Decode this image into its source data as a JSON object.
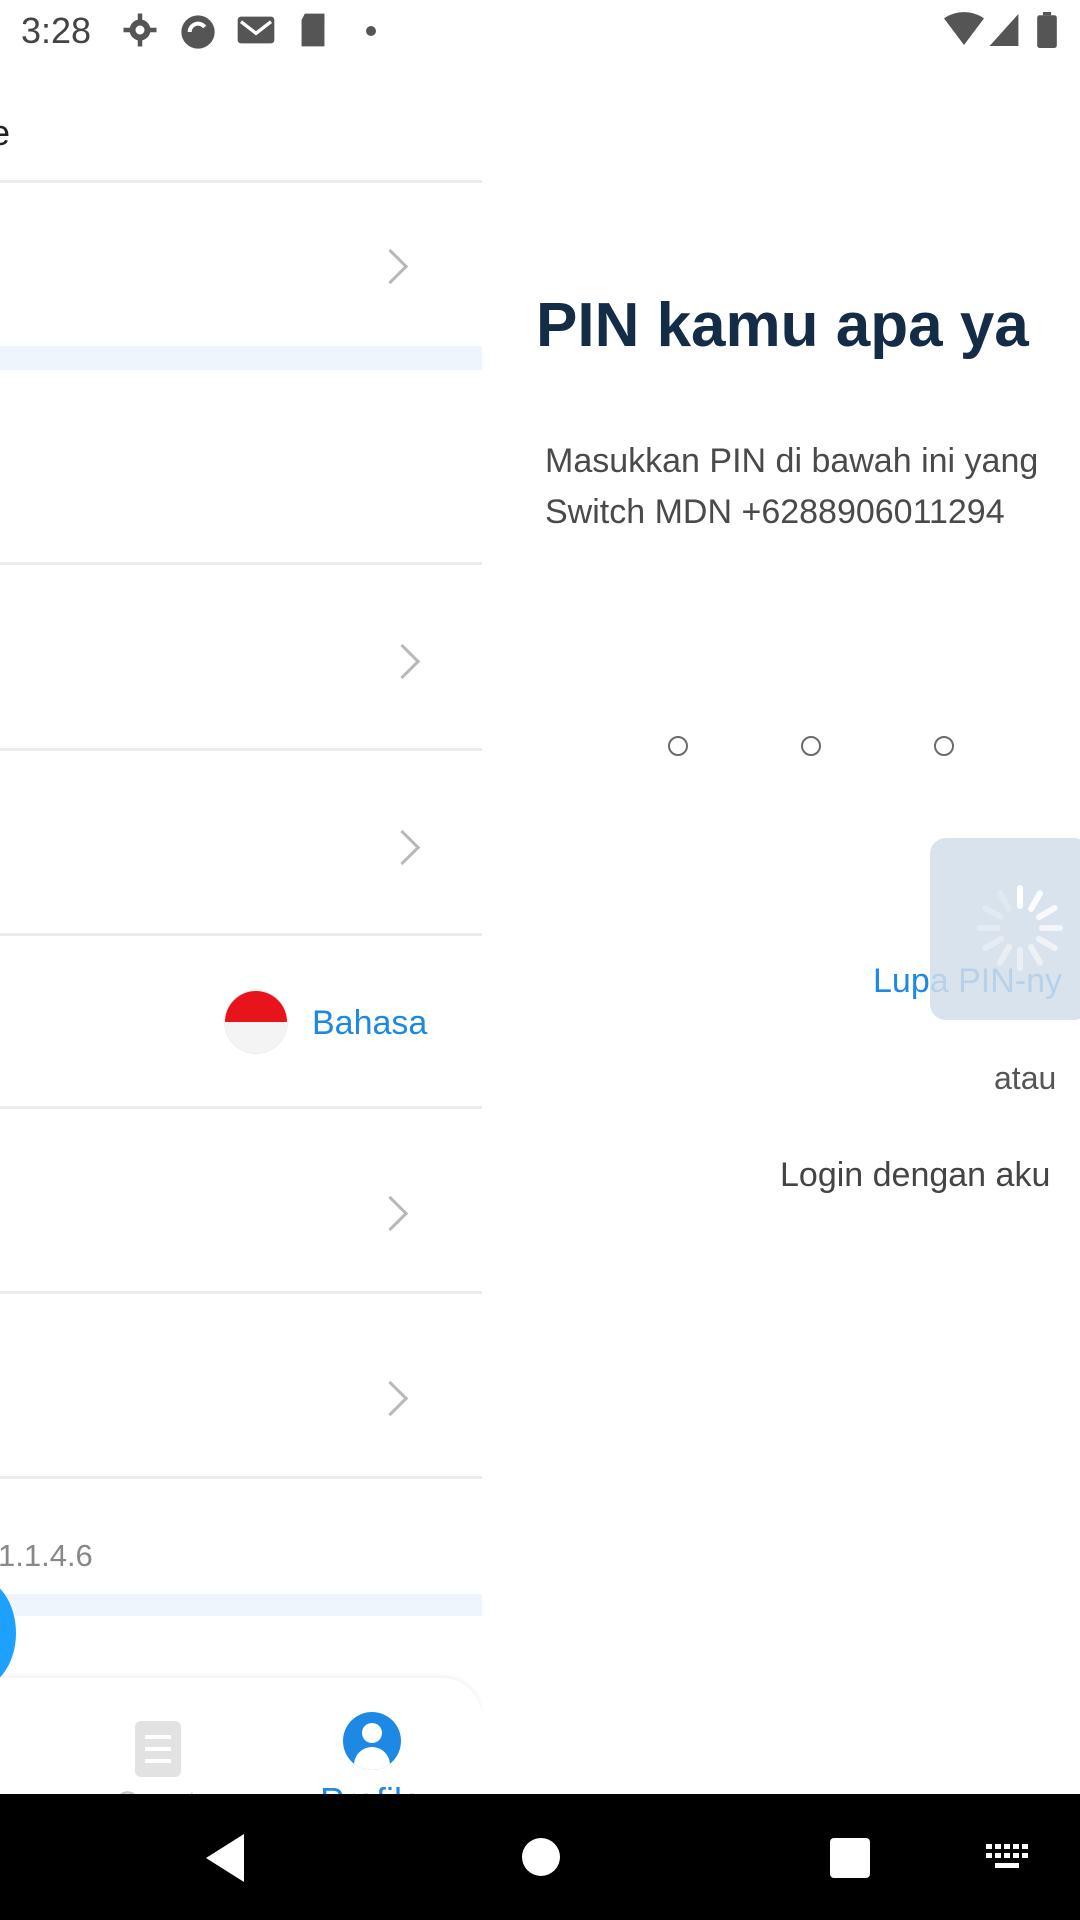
{
  "status_bar": {
    "time": "3:28"
  },
  "profile_pane": {
    "header_partial": "e",
    "language": {
      "label": "Bahasa",
      "flag": "indonesia-flag"
    },
    "version": "1.1.4.6",
    "bottom_nav": {
      "quest_label": "Quest",
      "profile_label": "Profile"
    }
  },
  "pin_screen": {
    "title": "PIN kamu apa ya",
    "desc_line1": "Masukkan PIN di bawah ini yang",
    "desc_line2": "Switch MDN +6288906011294",
    "pin_dots": 3,
    "forgot_pin": "Lupa PIN-ny",
    "or": "atau",
    "login_alt": "Login dengan aku"
  },
  "colors": {
    "accent": "#1e88e5",
    "title": "#142c46"
  }
}
